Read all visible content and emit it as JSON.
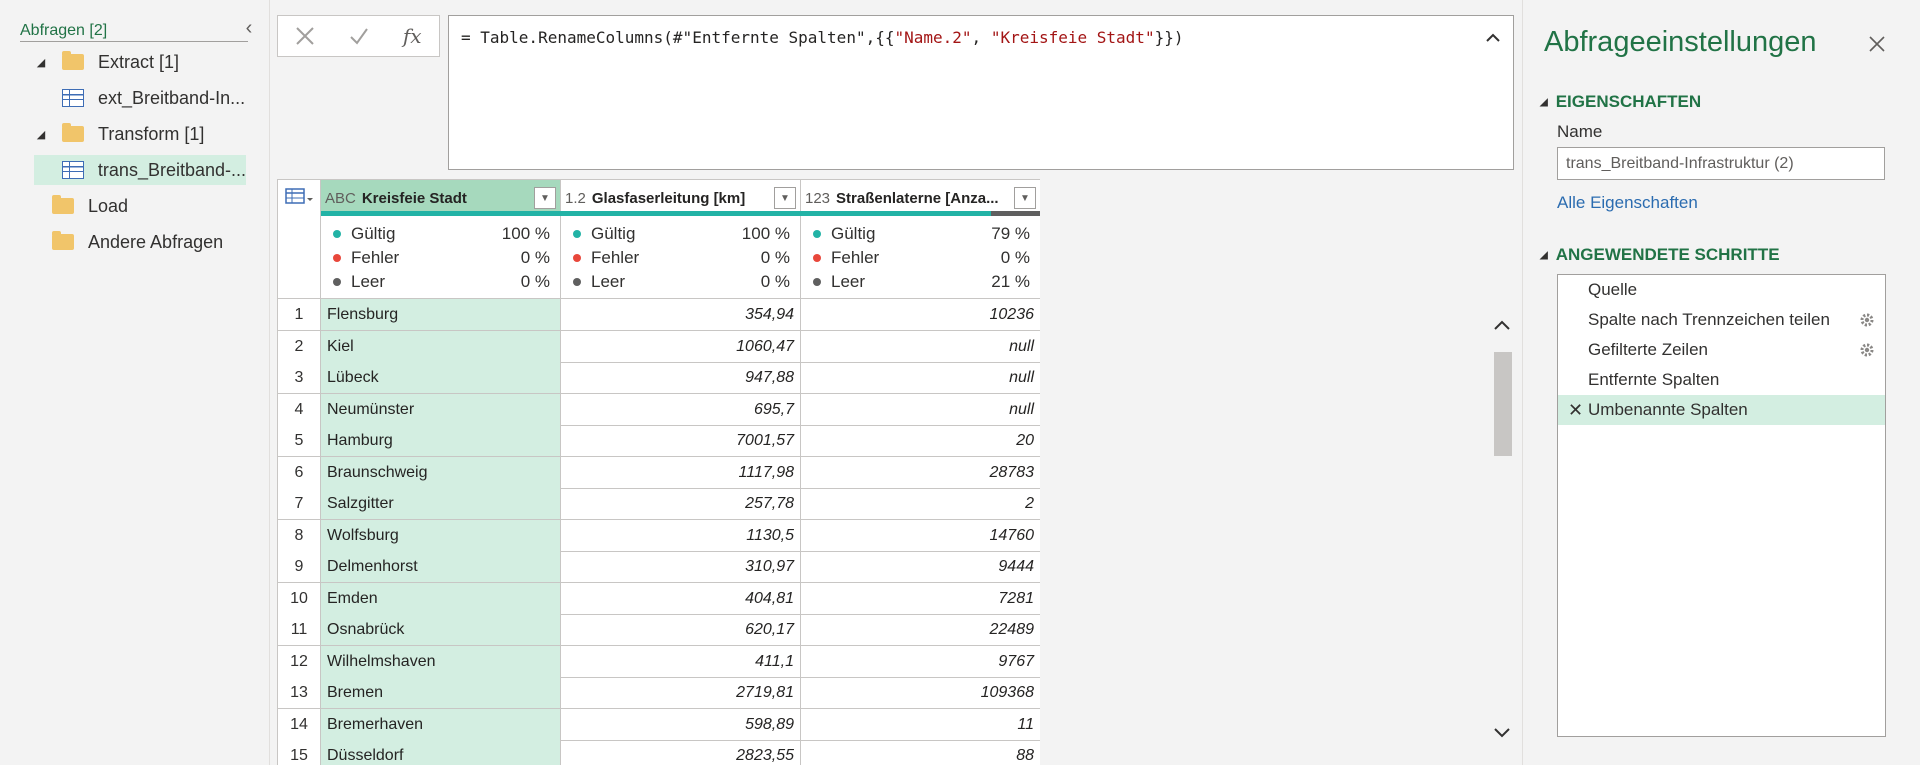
{
  "queries_pane": {
    "title": "Abfragen [2]",
    "items": [
      {
        "type": "group",
        "label": "Extract [1]",
        "expanded": true
      },
      {
        "type": "query",
        "label": "ext_Breitband-In...",
        "selected": false
      },
      {
        "type": "group",
        "label": "Transform [1]",
        "expanded": true
      },
      {
        "type": "query",
        "label": "trans_Breitband-...",
        "selected": true
      },
      {
        "type": "group",
        "label": "Load"
      },
      {
        "type": "group",
        "label": "Andere Abfragen"
      }
    ]
  },
  "formula_bar": {
    "cancel_icon": "close-icon",
    "confirm_icon": "check-icon",
    "fx_label": "fx",
    "formula_prefix": "= Table.RenameColumns(#\"Entfernte Spalten\",{{",
    "string1": "\"Name.2\"",
    "separator": ", ",
    "string2": "\"Kreisfeie Stadt\"",
    "formula_suffix": "}})"
  },
  "grid": {
    "columns": [
      {
        "type_label": "ABC",
        "title": "Kreisfeie Stadt",
        "selected": true,
        "quality": {
          "valid_label": "Gültig",
          "valid": "100 %",
          "error_label": "Fehler",
          "error": "0 %",
          "empty_label": "Leer",
          "empty": "0 %"
        },
        "valid_fraction": 1.0
      },
      {
        "type_label": "1.2",
        "title": "Glasfaserleitung [km]",
        "selected": false,
        "quality": {
          "valid_label": "Gültig",
          "valid": "100 %",
          "error_label": "Fehler",
          "error": "0 %",
          "empty_label": "Leer",
          "empty": "0 %"
        },
        "valid_fraction": 1.0
      },
      {
        "type_label": "123",
        "title": "Straßenlaterne [Anza...",
        "selected": false,
        "quality": {
          "valid_label": "Gültig",
          "valid": "79 %",
          "error_label": "Fehler",
          "error": "0 %",
          "empty_label": "Leer",
          "empty": "21 %"
        },
        "valid_fraction": 0.79
      }
    ],
    "rows": [
      [
        "1",
        "Flensburg",
        "354,94",
        "10236"
      ],
      [
        "2",
        "Kiel",
        "1060,47",
        "null"
      ],
      [
        "3",
        "Lübeck",
        "947,88",
        "null"
      ],
      [
        "4",
        "Neumünster",
        "695,7",
        "null"
      ],
      [
        "5",
        "Hamburg",
        "7001,57",
        "20"
      ],
      [
        "6",
        "Braunschweig",
        "1117,98",
        "28783"
      ],
      [
        "7",
        "Salzgitter",
        "257,78",
        "2"
      ],
      [
        "8",
        "Wolfsburg",
        "1130,5",
        "14760"
      ],
      [
        "9",
        "Delmenhorst",
        "310,97",
        "9444"
      ],
      [
        "10",
        "Emden",
        "404,81",
        "7281"
      ],
      [
        "11",
        "Osnabrück",
        "620,17",
        "22489"
      ],
      [
        "12",
        "Wilhelmshaven",
        "411,1",
        "9767"
      ],
      [
        "13",
        "Bremen",
        "2719,81",
        "109368"
      ],
      [
        "14",
        "Bremerhaven",
        "598,89",
        "11"
      ],
      [
        "15",
        "Düsseldorf",
        "2823,55",
        "88"
      ]
    ]
  },
  "settings_pane": {
    "title": "Abfrageeinstellungen",
    "properties_heading": "EIGENSCHAFTEN",
    "name_label": "Name",
    "name_value": "trans_Breitband-Infrastruktur (2)",
    "all_properties_link": "Alle Eigenschaften",
    "steps_heading": "ANGEWENDETE SCHRITTE",
    "steps": [
      {
        "label": "Quelle",
        "gear": false,
        "selected": false
      },
      {
        "label": "Spalte nach Trennzeichen teilen",
        "gear": true,
        "selected": false
      },
      {
        "label": "Gefilterte Zeilen",
        "gear": true,
        "selected": false
      },
      {
        "label": "Entfernte Spalten",
        "gear": false,
        "selected": false
      },
      {
        "label": "Umbenannte Spalten",
        "gear": false,
        "selected": true
      }
    ]
  },
  "colors": {
    "accent_green": "#217346",
    "selection_green": "#d3eee1",
    "header_selected": "#a6d9bd",
    "valid_teal": "#22b3a6",
    "error_red": "#e8473b",
    "empty_gray": "#5f5f5f",
    "link_blue": "#2b6cb0"
  }
}
